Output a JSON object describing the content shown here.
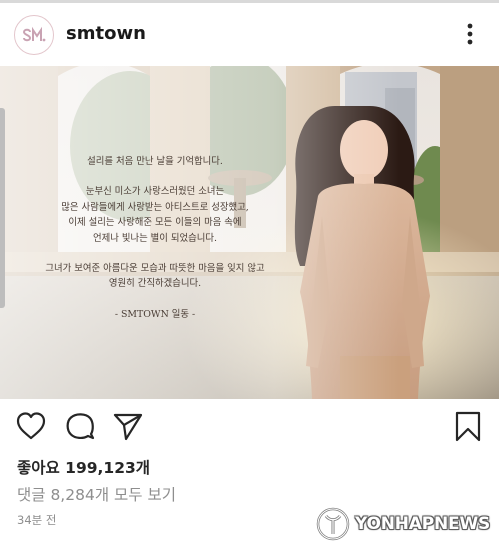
{
  "header": {
    "username": "smtown",
    "avatar_icon": "sm-logo-icon",
    "more_icon": "more-vertical-icon"
  },
  "post": {
    "caption_lines": [
      "설리를 처음 만난 날을 기억합니다.",
      "",
      "눈부신 미소가 사랑스러웠던 소녀는",
      "많은 사람들에게 사랑받는 아티스트로 성장했고,",
      "이제 설리는 사랑해준 모든 이들의 마음 속에",
      "언제나 빛나는 별이 되었습니다.",
      "",
      "그녀가 보여준 아름다운 모습과 따뜻한 마음을 잊지 않고",
      "영원히 간직하겠습니다.",
      "",
      "- SMTOWN 일동 -"
    ]
  },
  "actions": {
    "like_icon": "heart-icon",
    "comment_icon": "comment-icon",
    "share_icon": "send-icon",
    "save_icon": "bookmark-icon"
  },
  "stats": {
    "likes_label": "좋아요 199,123개",
    "comments_label": "댓글 8,284개 모두 보기",
    "time_label": "34분 전"
  },
  "watermark": {
    "text": "YONHAPNEWS"
  },
  "colors": {
    "text_primary": "#262626",
    "text_secondary": "#8e8e8e",
    "caption_text": "#4a3d35"
  }
}
